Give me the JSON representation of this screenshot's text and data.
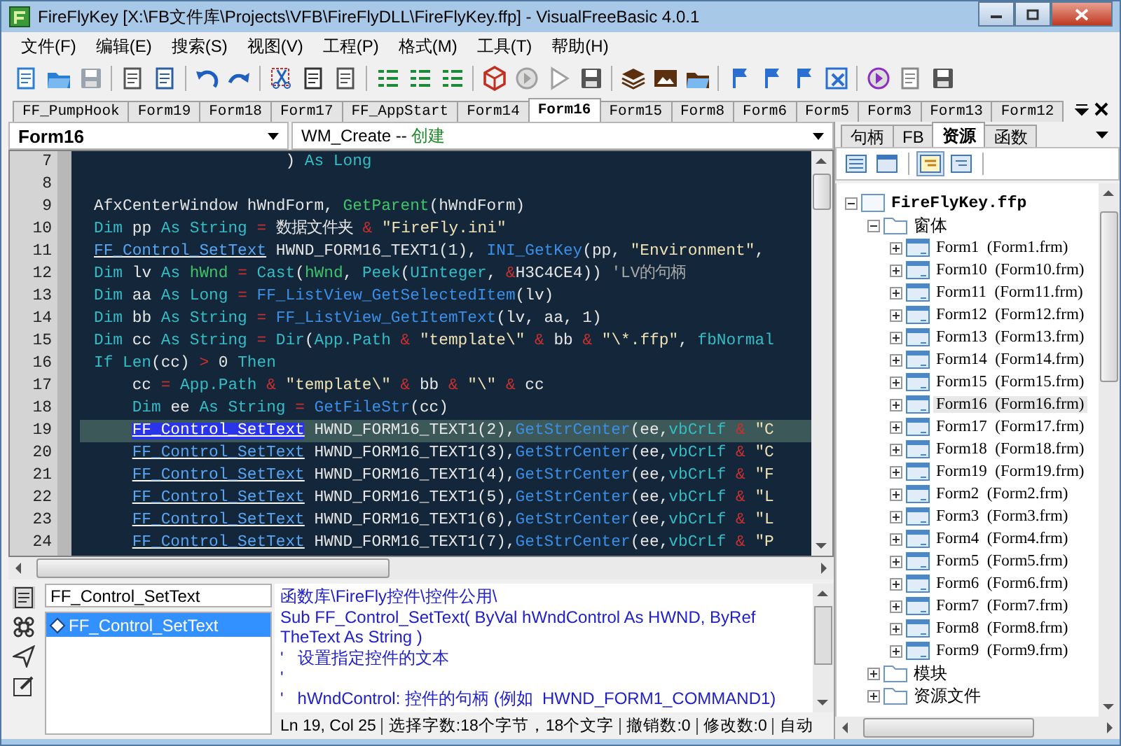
{
  "window": {
    "title": "FireFlyKey [X:\\FB文件库\\Projects\\VFB\\FireFlyDLL\\FireFlyKey.ffp] - VisualFreeBasic 4.0.1"
  },
  "menu": [
    "文件(F)",
    "编辑(E)",
    "搜索(S)",
    "视图(V)",
    "工程(P)",
    "格式(M)",
    "工具(T)",
    "帮助(H)"
  ],
  "file_tabs": [
    {
      "label": "FF_PumpHook",
      "selected": false
    },
    {
      "label": "Form19",
      "selected": false
    },
    {
      "label": "Form18",
      "selected": false
    },
    {
      "label": "Form17",
      "selected": false
    },
    {
      "label": "FF_AppStart",
      "selected": false
    },
    {
      "label": "Form14",
      "selected": false
    },
    {
      "label": "Form16",
      "selected": true
    },
    {
      "label": "Form15",
      "selected": false
    },
    {
      "label": "Form8",
      "selected": false
    },
    {
      "label": "Form6",
      "selected": false
    },
    {
      "label": "Form5",
      "selected": false
    },
    {
      "label": "Form3",
      "selected": false
    },
    {
      "label": "Form13",
      "selected": false
    },
    {
      "label": "Form12",
      "selected": false
    }
  ],
  "object_combo": {
    "value": "Form16"
  },
  "event_combo": {
    "event": "WM_Create --",
    "label": "创建"
  },
  "editor": {
    "lines": [
      {
        "number": "7",
        "current": false,
        "tokens": [
          {
            "kind": "plain",
            "text": "                    ) "
          },
          {
            "kind": "kw",
            "text": "As Long"
          }
        ]
      },
      {
        "number": "8",
        "current": false
      },
      {
        "number": "9",
        "current": false,
        "tokens": [
          {
            "kind": "plain",
            "text": "AfxCenterWindow hWndForm, "
          },
          {
            "kind": "fn",
            "text": "GetParent"
          },
          {
            "kind": "plain",
            "text": "(hWndForm)"
          }
        ]
      },
      {
        "number": "10",
        "current": false,
        "tokens": [
          {
            "kind": "kw",
            "text": "Dim"
          },
          {
            "kind": "plain",
            "text": " pp "
          },
          {
            "kind": "kw",
            "text": "As String "
          },
          {
            "kind": "op",
            "text": "="
          },
          {
            "kind": "plain",
            "text": " 数据文件夹 "
          },
          {
            "kind": "op",
            "text": "& "
          },
          {
            "kind": "str",
            "text": "\"FireFly.ini\""
          }
        ]
      },
      {
        "number": "11",
        "current": false,
        "tokens": [
          {
            "kind": "link",
            "text": "FF_Control_SetText",
            "selected": false
          },
          {
            "kind": "plain",
            "text": " HWND_FORM16_TEXT1(1), "
          },
          {
            "kind": "call",
            "text": "INI_GetKey"
          },
          {
            "kind": "plain",
            "text": "(pp, "
          },
          {
            "kind": "str",
            "text": "\"Environment\""
          },
          {
            "kind": "plain",
            "text": ","
          }
        ]
      },
      {
        "number": "12",
        "current": false,
        "tokens": [
          {
            "kind": "kw",
            "text": "Dim"
          },
          {
            "kind": "plain",
            "text": " lv "
          },
          {
            "kind": "kw",
            "text": "As "
          },
          {
            "kind": "fn",
            "text": "hWnd "
          },
          {
            "kind": "op",
            "text": "= "
          },
          {
            "kind": "kw",
            "text": "Cast"
          },
          {
            "kind": "plain",
            "text": "("
          },
          {
            "kind": "fn",
            "text": "hWnd"
          },
          {
            "kind": "plain",
            "text": ", "
          },
          {
            "kind": "kw",
            "text": "Peek"
          },
          {
            "kind": "plain",
            "text": "("
          },
          {
            "kind": "kw",
            "text": "UInteger"
          },
          {
            "kind": "plain",
            "text": ", "
          },
          {
            "kind": "op",
            "text": "&"
          },
          {
            "kind": "plain",
            "text": "H3C4CE4)) "
          },
          {
            "kind": "cmt",
            "text": "'LV的句柄"
          }
        ]
      },
      {
        "number": "13",
        "current": false,
        "tokens": [
          {
            "kind": "kw",
            "text": "Dim"
          },
          {
            "kind": "plain",
            "text": " aa "
          },
          {
            "kind": "kw",
            "text": "As Long "
          },
          {
            "kind": "op",
            "text": "= "
          },
          {
            "kind": "call",
            "text": "FF_ListView_GetSelectedItem"
          },
          {
            "kind": "plain",
            "text": "(lv)"
          }
        ]
      },
      {
        "number": "14",
        "current": false,
        "tokens": [
          {
            "kind": "kw",
            "text": "Dim"
          },
          {
            "kind": "plain",
            "text": " bb "
          },
          {
            "kind": "kw",
            "text": "As String "
          },
          {
            "kind": "op",
            "text": "= "
          },
          {
            "kind": "call",
            "text": "FF_ListView_GetItemText"
          },
          {
            "kind": "plain",
            "text": "(lv, aa, 1)"
          }
        ]
      },
      {
        "number": "15",
        "current": false,
        "tokens": [
          {
            "kind": "kw",
            "text": "Dim"
          },
          {
            "kind": "plain",
            "text": " cc "
          },
          {
            "kind": "kw",
            "text": "As String "
          },
          {
            "kind": "op",
            "text": "= "
          },
          {
            "kind": "kw",
            "text": "Dir"
          },
          {
            "kind": "plain",
            "text": "("
          },
          {
            "kind": "kw",
            "text": "App.Path "
          },
          {
            "kind": "op",
            "text": "& "
          },
          {
            "kind": "str",
            "text": "\"template\\\" "
          },
          {
            "kind": "op",
            "text": "&"
          },
          {
            "kind": "plain",
            "text": " bb "
          },
          {
            "kind": "op",
            "text": "& "
          },
          {
            "kind": "str",
            "text": "\"\\*.ffp\""
          },
          {
            "kind": "plain",
            "text": ", "
          },
          {
            "kind": "kw",
            "text": "fbNormal"
          }
        ]
      },
      {
        "number": "16",
        "current": false,
        "tokens": [
          {
            "kind": "kw",
            "text": "If Len"
          },
          {
            "kind": "plain",
            "text": "(cc) "
          },
          {
            "kind": "op",
            "text": ">"
          },
          {
            "kind": "plain",
            "text": " 0 "
          },
          {
            "kind": "kw",
            "text": "Then"
          }
        ]
      },
      {
        "number": "17",
        "current": false,
        "tokens": [
          {
            "kind": "plain",
            "text": "    cc "
          },
          {
            "kind": "op",
            "text": "= "
          },
          {
            "kind": "kw",
            "text": "App.Path "
          },
          {
            "kind": "op",
            "text": "& "
          },
          {
            "kind": "str",
            "text": "\"template\\\" "
          },
          {
            "kind": "op",
            "text": "&"
          },
          {
            "kind": "plain",
            "text": " bb "
          },
          {
            "kind": "op",
            "text": "& "
          },
          {
            "kind": "str",
            "text": "\"\\\" "
          },
          {
            "kind": "op",
            "text": "&"
          },
          {
            "kind": "plain",
            "text": " cc"
          }
        ]
      },
      {
        "number": "18",
        "current": false,
        "tokens": [
          {
            "kind": "kw",
            "text": "    Dim"
          },
          {
            "kind": "plain",
            "text": " ee "
          },
          {
            "kind": "kw",
            "text": "As String "
          },
          {
            "kind": "op",
            "text": "= "
          },
          {
            "kind": "call",
            "text": "GetFileStr"
          },
          {
            "kind": "plain",
            "text": "(cc)"
          }
        ]
      },
      {
        "number": "19",
        "current": true,
        "tokens": [
          {
            "kind": "link",
            "text": "    FF_Control_SetText",
            "selected": true
          },
          {
            "kind": "plain",
            "text": " HWND_FORM16_TEXT1(2),"
          },
          {
            "kind": "call",
            "text": "GetStrCenter"
          },
          {
            "kind": "plain",
            "text": "(ee,"
          },
          {
            "kind": "kw",
            "text": "vbCrLf "
          },
          {
            "kind": "op",
            "text": "& "
          },
          {
            "kind": "str",
            "text": "\"C"
          }
        ]
      },
      {
        "number": "20",
        "current": false,
        "tokens": [
          {
            "kind": "link",
            "text": "    FF_Control_SetText",
            "selected": false
          },
          {
            "kind": "plain",
            "text": " HWND_FORM16_TEXT1(3),"
          },
          {
            "kind": "call",
            "text": "GetStrCenter"
          },
          {
            "kind": "plain",
            "text": "(ee,"
          },
          {
            "kind": "kw",
            "text": "vbCrLf "
          },
          {
            "kind": "op",
            "text": "& "
          },
          {
            "kind": "str",
            "text": "\"C"
          }
        ]
      },
      {
        "number": "21",
        "current": false,
        "tokens": [
          {
            "kind": "link",
            "text": "    FF_Control_SetText",
            "selected": false
          },
          {
            "kind": "plain",
            "text": " HWND_FORM16_TEXT1(4),"
          },
          {
            "kind": "call",
            "text": "GetStrCenter"
          },
          {
            "kind": "plain",
            "text": "(ee,"
          },
          {
            "kind": "kw",
            "text": "vbCrLf "
          },
          {
            "kind": "op",
            "text": "& "
          },
          {
            "kind": "str",
            "text": "\"F"
          }
        ]
      },
      {
        "number": "22",
        "current": false,
        "tokens": [
          {
            "kind": "link",
            "text": "    FF_Control_SetText",
            "selected": false
          },
          {
            "kind": "plain",
            "text": " HWND_FORM16_TEXT1(5),"
          },
          {
            "kind": "call",
            "text": "GetStrCenter"
          },
          {
            "kind": "plain",
            "text": "(ee,"
          },
          {
            "kind": "kw",
            "text": "vbCrLf "
          },
          {
            "kind": "op",
            "text": "& "
          },
          {
            "kind": "str",
            "text": "\"L"
          }
        ]
      },
      {
        "number": "23",
        "current": false,
        "tokens": [
          {
            "kind": "link",
            "text": "    FF_Control_SetText",
            "selected": false
          },
          {
            "kind": "plain",
            "text": " HWND_FORM16_TEXT1(6),"
          },
          {
            "kind": "call",
            "text": "GetStrCenter"
          },
          {
            "kind": "plain",
            "text": "(ee,"
          },
          {
            "kind": "kw",
            "text": "vbCrLf "
          },
          {
            "kind": "op",
            "text": "& "
          },
          {
            "kind": "str",
            "text": "\"L"
          }
        ]
      },
      {
        "number": "24",
        "current": false,
        "tokens": [
          {
            "kind": "link",
            "text": "    FF_Control_SetText",
            "selected": false
          },
          {
            "kind": "plain",
            "text": " HWND_FORM16_TEXT1(7),"
          },
          {
            "kind": "call",
            "text": "GetStrCenter"
          },
          {
            "kind": "plain",
            "text": "(ee,"
          },
          {
            "kind": "kw",
            "text": "vbCrLf "
          },
          {
            "kind": "op",
            "text": "& "
          },
          {
            "kind": "str",
            "text": "\"P"
          }
        ]
      }
    ]
  },
  "lookup": {
    "search": {
      "value": "FF_Control_SetText"
    },
    "results": [
      {
        "label": "FF_Control_SetText",
        "selected": true
      }
    ]
  },
  "doc_lines": [
    "函数库\\FireFly控件\\控件公用\\",
    "Sub FF_Control_SetText( ByVal hWndControl As HWND, ByRef TheText As String )",
    "'   设置指定控件的文本",
    "'",
    "'   hWndControl: 控件的句柄 (例如  HWND_FORM1_COMMAND1)"
  ],
  "status_bar": [
    "Ln 19,  Col 25",
    "选择字数:18个字节，18个文字",
    "撤销数:0",
    "修改数:0",
    "自动"
  ],
  "side_tabs": [
    {
      "label": "句柄",
      "selected": false
    },
    {
      "label": "FB",
      "selected": false
    },
    {
      "label": "资源",
      "selected": true
    },
    {
      "label": "函数",
      "selected": false
    }
  ],
  "tree": [
    {
      "label": "FireFlyKey.ffp",
      "kind": "project",
      "expanded": true,
      "selected": false,
      "children": [
        {
          "label": "窗体",
          "kind": "folder",
          "expanded": true,
          "selected": false,
          "children": [
            {
              "label": "Form1  (Form1.frm)",
              "kind": "form",
              "expanded": false,
              "selected": false
            },
            {
              "label": "Form10  (Form10.frm)",
              "kind": "form",
              "expanded": false,
              "selected": false
            },
            {
              "label": "Form11  (Form11.frm)",
              "kind": "form",
              "expanded": false,
              "selected": false
            },
            {
              "label": "Form12  (Form12.frm)",
              "kind": "form",
              "expanded": false,
              "selected": false
            },
            {
              "label": "Form13  (Form13.frm)",
              "kind": "form",
              "expanded": false,
              "selected": false
            },
            {
              "label": "Form14  (Form14.frm)",
              "kind": "form",
              "expanded": false,
              "selected": false
            },
            {
              "label": "Form15  (Form15.frm)",
              "kind": "form",
              "expanded": false,
              "selected": false
            },
            {
              "label": "Form16  (Form16.frm)",
              "kind": "form",
              "expanded": false,
              "selected": true
            },
            {
              "label": "Form17  (Form17.frm)",
              "kind": "form",
              "expanded": false,
              "selected": false
            },
            {
              "label": "Form18  (Form18.frm)",
              "kind": "form",
              "expanded": false,
              "selected": false
            },
            {
              "label": "Form19  (Form19.frm)",
              "kind": "form",
              "expanded": false,
              "selected": false
            },
            {
              "label": "Form2  (Form2.frm)",
              "kind": "form",
              "expanded": false,
              "selected": false
            },
            {
              "label": "Form3  (Form3.frm)",
              "kind": "form",
              "expanded": false,
              "selected": false
            },
            {
              "label": "Form4  (Form4.frm)",
              "kind": "form",
              "expanded": false,
              "selected": false
            },
            {
              "label": "Form5  (Form5.frm)",
              "kind": "form",
              "expanded": false,
              "selected": false
            },
            {
              "label": "Form6  (Form6.frm)",
              "kind": "form",
              "expanded": false,
              "selected": false
            },
            {
              "label": "Form7  (Form7.frm)",
              "kind": "form",
              "expanded": false,
              "selected": false
            },
            {
              "label": "Form8  (Form8.frm)",
              "kind": "form",
              "expanded": false,
              "selected": false
            },
            {
              "label": "Form9  (Form9.frm)",
              "kind": "form",
              "expanded": false,
              "selected": false
            }
          ]
        },
        {
          "label": "模块",
          "kind": "folder",
          "expanded": false,
          "selected": false
        },
        {
          "label": "资源文件",
          "kind": "folder",
          "expanded": false,
          "selected": false
        }
      ]
    }
  ]
}
